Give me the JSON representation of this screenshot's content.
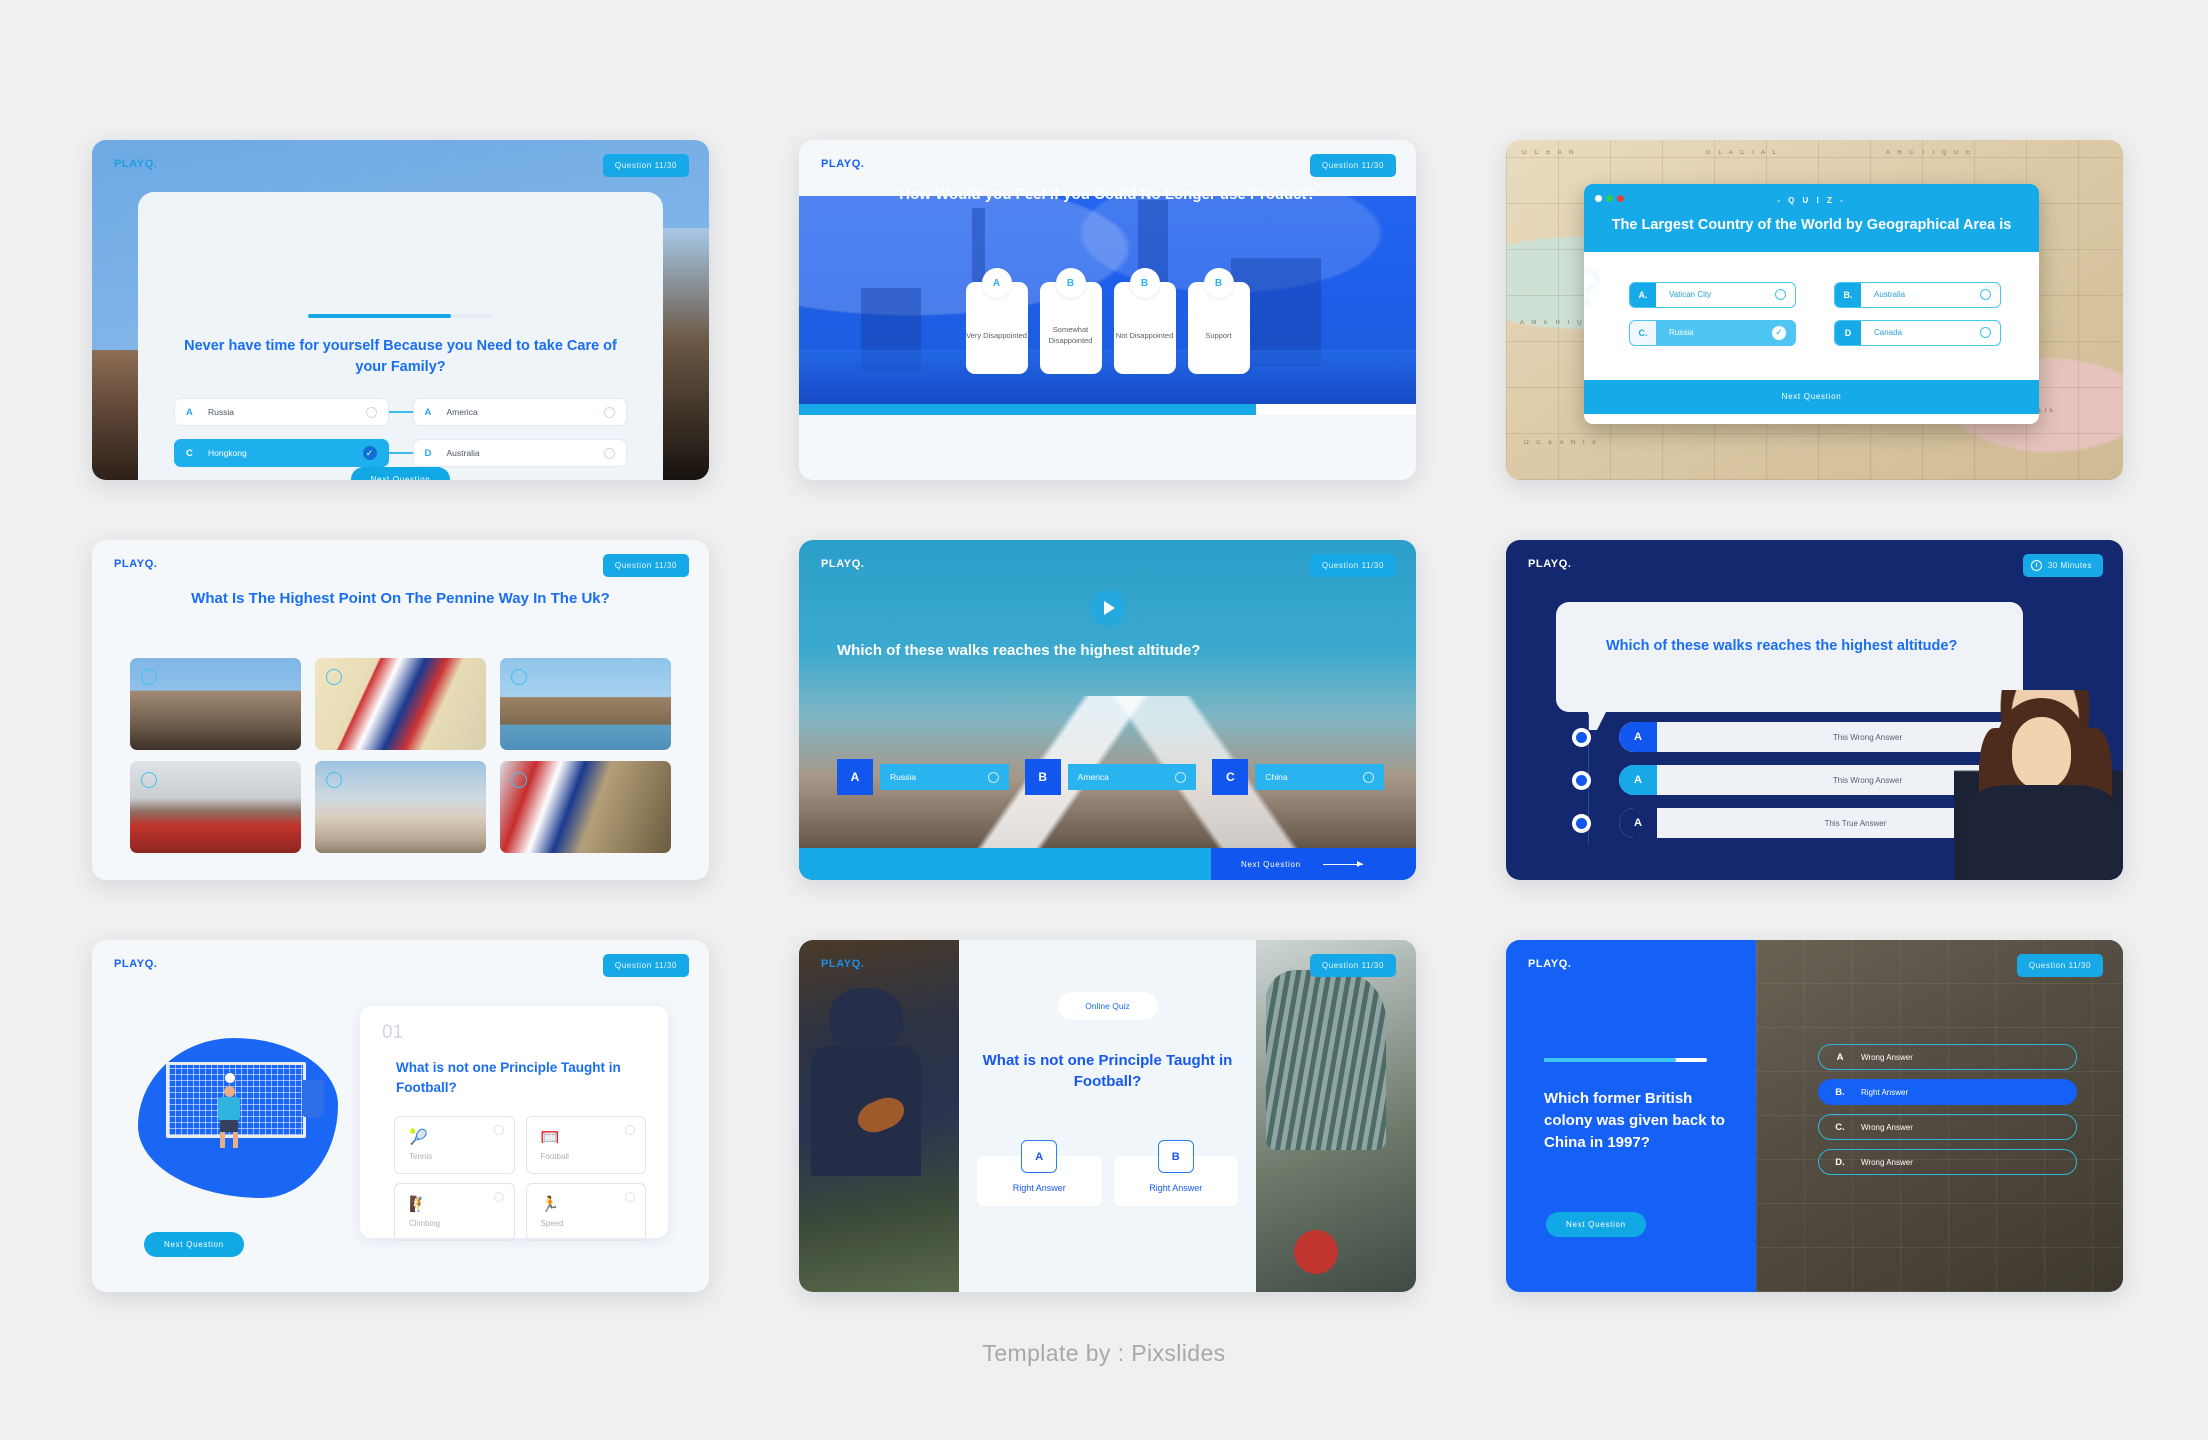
{
  "brand": {
    "logo": "PLAYQ.",
    "accent": "#17a8e8",
    "blue": "#1560f5",
    "navy": "#13286e"
  },
  "footer": {
    "credit": "Template by : Pixslides"
  },
  "slides": [
    {
      "id": "slide-1",
      "logo": "PLAYQ.",
      "badge": "Question 11/30",
      "question": "Never have time for yourself Because you Need to take Care of your Family?",
      "next_label": "Next Question",
      "progress_percent": 77,
      "options": [
        {
          "letter": "A",
          "text": "Russia",
          "selected": false
        },
        {
          "letter": "A",
          "text": "America",
          "selected": false
        },
        {
          "letter": "C",
          "text": "Hongkong",
          "selected": true
        },
        {
          "letter": "D",
          "text": "Australia",
          "selected": false
        }
      ]
    },
    {
      "id": "slide-2",
      "logo": "PLAYQ.",
      "badge": "Question 11/30",
      "question": "How Would you Feel if you Could No Longer use Product?",
      "progress_percent": 74,
      "options": [
        {
          "letter": "A",
          "text": "Very Disappointed"
        },
        {
          "letter": "B",
          "text": "Somewhat Disappointed"
        },
        {
          "letter": "B",
          "text": "Not Disappointed"
        },
        {
          "letter": "B",
          "text": "Support"
        }
      ]
    },
    {
      "id": "slide-3",
      "kicker": "- Q U I Z -",
      "question": "The Largest Country of the World by Geographical Area is",
      "next_label": "Next Question",
      "options": [
        {
          "letter": "A.",
          "text": "Vatican City",
          "selected": false
        },
        {
          "letter": "B.",
          "text": "Australia",
          "selected": false
        },
        {
          "letter": "C.",
          "text": "Russia",
          "selected": true
        },
        {
          "letter": "D",
          "text": "Canada",
          "selected": false
        }
      ]
    },
    {
      "id": "slide-4",
      "logo": "PLAYQ.",
      "badge": "Question 11/30",
      "question": "What Is The Highest Point On The Pennine Way In The Uk?",
      "thumbnails": [
        "tower-of-london-photo",
        "union-jack-big-ben-photo",
        "westminster-thames-photo",
        "london-street-bus-photo",
        "london-eye-photo",
        "union-jack-clock-photo"
      ]
    },
    {
      "id": "slide-5",
      "logo": "PLAYQ.",
      "badge": "Question 11/30",
      "question": "Which of these walks reaches the highest altitude?",
      "next_label": "Next Question",
      "options": [
        {
          "letter": "A",
          "text": "Russia"
        },
        {
          "letter": "B",
          "text": "America"
        },
        {
          "letter": "C",
          "text": "China"
        }
      ]
    },
    {
      "id": "slide-6",
      "logo": "PLAYQ.",
      "badge": "30 Minutes",
      "question": "Which of these walks reaches the highest altitude?",
      "options": [
        {
          "letter": "A",
          "text": "This Wrong Answer",
          "style": "blue",
          "locked": false
        },
        {
          "letter": "A",
          "text": "This Wrong Answer",
          "style": "cyan",
          "locked": false
        },
        {
          "letter": "A",
          "text": "This True Answer",
          "style": "navy",
          "locked": true
        }
      ]
    },
    {
      "id": "slide-7",
      "logo": "PLAYQ.",
      "badge": "Question 11/30",
      "number": "01",
      "question": "What is not one Principle Taught in Football?",
      "next_label": "Next Question",
      "options": [
        {
          "icon": "tennis-racket-icon",
          "glyph": "🎾",
          "text": "Tennis"
        },
        {
          "icon": "football-goal-icon",
          "glyph": "🥅",
          "text": "Football"
        },
        {
          "icon": "climbing-icon",
          "glyph": "🧗",
          "text": "Climbing"
        },
        {
          "icon": "speed-icon",
          "glyph": "🏃",
          "text": "Speed"
        }
      ]
    },
    {
      "id": "slide-8",
      "logo": "PLAYQ.",
      "badge": "Question 11/30",
      "pill": "Online Quiz",
      "question": "What is not one Principle Taught in Football?",
      "options": [
        {
          "letter": "A",
          "text": "Right Answer"
        },
        {
          "letter": "B",
          "text": "Right Answer"
        }
      ]
    },
    {
      "id": "slide-9",
      "logo": "PLAYQ.",
      "badge": "Question 11/30",
      "question": "Which former British colony was given back to China in 1997?",
      "next_label": "Next Question",
      "progress_percent": 81,
      "options": [
        {
          "letter": "A",
          "text": "Wrong Answer",
          "selected": false
        },
        {
          "letter": "B.",
          "text": "Right Answer",
          "selected": true
        },
        {
          "letter": "C.",
          "text": "Wrong Answer",
          "selected": false
        },
        {
          "letter": "D.",
          "text": "Wrong Answer",
          "selected": false
        }
      ]
    }
  ]
}
